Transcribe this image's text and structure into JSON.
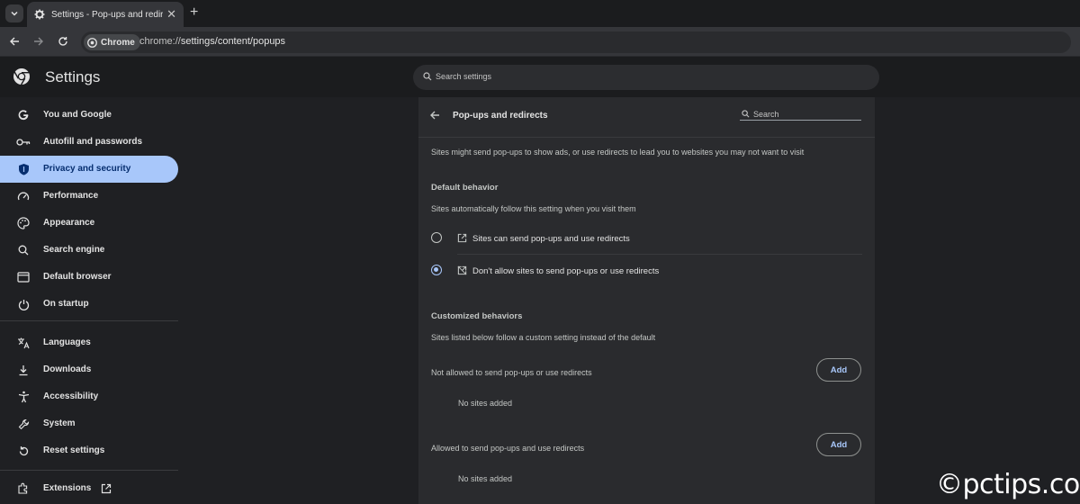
{
  "browser": {
    "tab": {
      "title": "Settings - Pop-ups and redirects"
    },
    "omnibox": {
      "chip_label": "Chrome",
      "url_scheme": "chrome://",
      "url_path": "settings/content/popups"
    }
  },
  "settings": {
    "title": "Settings",
    "search_placeholder": "Search settings"
  },
  "sidebar": {
    "items": [
      {
        "label": "You and Google",
        "icon": "google-g-icon"
      },
      {
        "label": "Autofill and passwords",
        "icon": "key-icon"
      },
      {
        "label": "Privacy and security",
        "icon": "shield-icon",
        "active": true
      },
      {
        "label": "Performance",
        "icon": "speedometer-icon"
      },
      {
        "label": "Appearance",
        "icon": "palette-icon"
      },
      {
        "label": "Search engine",
        "icon": "search-icon"
      },
      {
        "label": "Default browser",
        "icon": "browser-window-icon"
      },
      {
        "label": "On startup",
        "icon": "power-icon"
      },
      {
        "label": "Languages",
        "icon": "translate-icon"
      },
      {
        "label": "Downloads",
        "icon": "download-icon"
      },
      {
        "label": "Accessibility",
        "icon": "accessibility-icon"
      },
      {
        "label": "System",
        "icon": "wrench-icon"
      },
      {
        "label": "Reset settings",
        "icon": "reset-icon"
      },
      {
        "label": "Extensions",
        "icon": "puzzle-icon"
      }
    ],
    "accent_color": "#a8c7fa"
  },
  "popups": {
    "title": "Pop-ups and redirects",
    "search_placeholder": "Search",
    "description": "Sites might send pop-ups to show ads, or use redirects to lead you to websites you may not want to visit",
    "default_behavior": {
      "heading": "Default behavior",
      "subtext": "Sites automatically follow this setting when you visit them",
      "options": [
        {
          "label": "Sites can send pop-ups and use redirects",
          "checked": false
        },
        {
          "label": "Don't allow sites to send pop-ups or use redirects",
          "checked": true
        }
      ]
    },
    "customized": {
      "heading": "Customized behaviors",
      "subtext": "Sites listed below follow a custom setting instead of the default",
      "not_allowed": {
        "label": "Not allowed to send pop-ups or use redirects",
        "add_label": "Add",
        "empty": "No sites added"
      },
      "allowed": {
        "label": "Allowed to send pop-ups and use redirects",
        "add_label": "Add",
        "empty": "No sites added"
      }
    }
  },
  "watermark": "©pctips.com"
}
